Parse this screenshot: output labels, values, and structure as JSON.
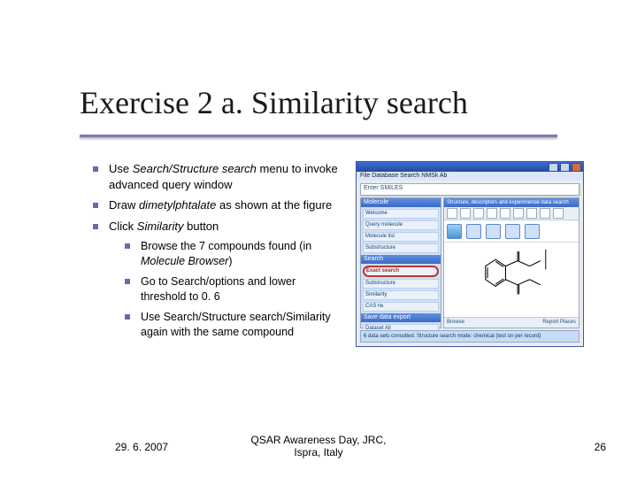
{
  "title": "Exercise 2 a. Similarity search",
  "bullets": {
    "b1_pre": "Use ",
    "b1_ital": "Search/Structure search",
    "b1_post": " menu to invoke advanced query window",
    "b2_pre": "Draw ",
    "b2_ital": "dimetylphtalate",
    "b2_post": " as shown at the figure",
    "b3_pre": "Click ",
    "b3_ital": "Similarity",
    "b3_post": " button",
    "s1_pre": "Browse  the 7 compounds found (in ",
    "s1_ital": "Molecule Browser",
    "s1_post": ")",
    "s2": "Go to Search/options and lower threshold to 0. 6",
    "s3": "Use Search/Structure search/Similarity again with the same compound"
  },
  "footer": {
    "date": "29. 6. 2007",
    "center_line1": "QSAR Awareness Day, JRC,",
    "center_line2": "Ispra, Italy",
    "page": "26"
  },
  "screenshot": {
    "menu_text": "File  Database  Search  NMSk  Ab",
    "smiles_label": "Enter SMILES",
    "left": {
      "hd1": "Molecule",
      "it_mol": "Welcome",
      "it_q": "Query molecule",
      "it_d": "Molecule list",
      "it_s": "Substructure",
      "hd2": "Search",
      "opt_exact": "Exact search",
      "opt_sub": "Substructure",
      "opt_sim": "Similarity",
      "opt_cas": "CAS №",
      "hd3": "Save data export",
      "status_btn": "Dataset  All"
    },
    "right": {
      "hd": "Structure, descriptors and experimental data search",
      "bot_left": "Browse",
      "bot_right": "Report  Places"
    },
    "statusbar": "6 data sets consulted.      Structure search mode: chemical (test on per record)"
  }
}
